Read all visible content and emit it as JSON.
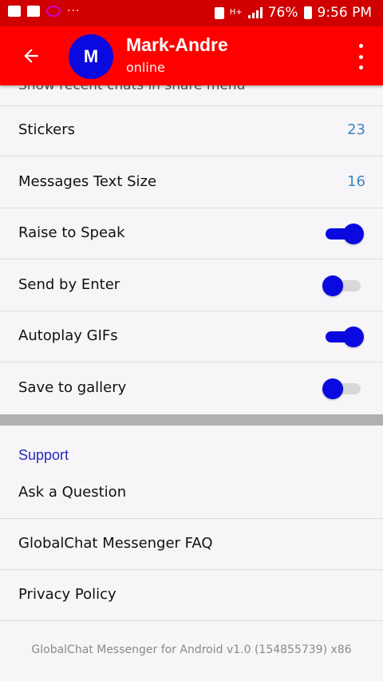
{
  "status_bar": {
    "left_icons": [
      "image-icon",
      "chat-icon",
      "app-logo-icon"
    ],
    "dots": "···",
    "network": "H+",
    "battery": "76%",
    "time": "9:56 PM"
  },
  "header": {
    "avatar_letter": "M",
    "name": "Mark-Andre",
    "status": "online",
    "colors": {
      "bar": "#ff0000",
      "avatar": "#0a0ae0"
    }
  },
  "settings": {
    "partial_row": "Show recent chats in share menu",
    "stickers": {
      "label": "Stickers",
      "value": "23"
    },
    "text_size": {
      "label": "Messages Text Size",
      "value": "16"
    },
    "raise_to_speak": {
      "label": "Raise to Speak",
      "on": true
    },
    "send_by_enter": {
      "label": "Send by Enter",
      "on": false
    },
    "autoplay_gifs": {
      "label": "Autoplay GIFs",
      "on": true
    },
    "save_to_gallery": {
      "label": "Save to gallery",
      "on": false
    }
  },
  "support": {
    "header": "Support",
    "items": [
      "Ask a Question",
      "GlobalChat Messenger FAQ",
      "Privacy Policy"
    ]
  },
  "footer": "GlobalChat Messenger for Android v1.0 (154855739) x86",
  "accent_colors": {
    "toggle": "#0a0ae0",
    "value_text": "#3a86c0",
    "section_header": "#2828b8"
  }
}
